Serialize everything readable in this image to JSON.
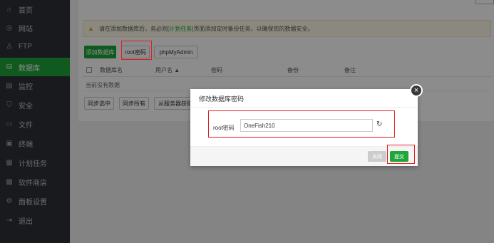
{
  "sidebar": {
    "items": [
      {
        "label": "首页",
        "icon": "home-icon",
        "glyph": "⌂"
      },
      {
        "label": "网站",
        "icon": "globe-icon",
        "glyph": "◎"
      },
      {
        "label": "FTP",
        "icon": "user-icon",
        "glyph": "♙"
      },
      {
        "label": "数据库",
        "icon": "database-icon",
        "glyph": "⛁",
        "active": true
      },
      {
        "label": "监控",
        "icon": "monitor-icon",
        "glyph": "▤"
      },
      {
        "label": "安全",
        "icon": "shield-icon",
        "glyph": "⛉"
      },
      {
        "label": "文件",
        "icon": "folder-icon",
        "glyph": "▭"
      },
      {
        "label": "终端",
        "icon": "terminal-icon",
        "glyph": "▣"
      },
      {
        "label": "计划任务",
        "icon": "calendar-icon",
        "glyph": "▦"
      },
      {
        "label": "软件商店",
        "icon": "grid-icon",
        "glyph": "▩"
      },
      {
        "label": "面板设置",
        "icon": "gear-icon",
        "glyph": "⚙"
      },
      {
        "label": "退出",
        "icon": "logout-icon",
        "glyph": "⇥"
      }
    ]
  },
  "alert": {
    "text_before": "请在添加数据库后，务必到",
    "link": "[计划任务]",
    "text_after": "页面添加定时备份任务，以确保您的数据安全。"
  },
  "toolbar": {
    "add_db": "添加数据库",
    "root_pwd": "root密码",
    "phpmyadmin": "phpMyAdmin"
  },
  "table": {
    "headers": [
      "数据库名",
      "用户名 ▲",
      "密码",
      "备份",
      "备注"
    ],
    "empty": "当前没有数据"
  },
  "bottom_buttons": [
    "同步选中",
    "同步所有",
    "从服务器获取"
  ],
  "modal": {
    "title": "修改数据库密码",
    "field_label": "root密码",
    "field_value": "OneFish210",
    "close_label": "关闭",
    "submit_label": "提交"
  },
  "colors": {
    "brand_green": "#20a53a",
    "sidebar_bg": "#2c3138",
    "highlight_red": "#e02020"
  }
}
